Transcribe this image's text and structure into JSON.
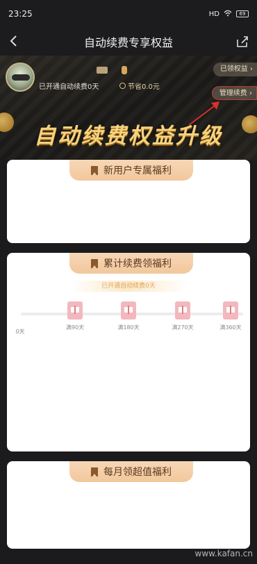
{
  "status_bar": {
    "time": "23:25",
    "signal": "HD",
    "wifi": "wifi-icon",
    "battery": "69"
  },
  "nav": {
    "title": "自动续费专享权益",
    "back_icon": "chevron-left-icon",
    "share_icon": "share-icon"
  },
  "header": {
    "renew_days": "已开通自动续费0天",
    "saved": "节省0.0元",
    "received_pill": "已领权益 ›",
    "manage_pill": "管理续费 ›",
    "banner_title": "自动续费权益升级"
  },
  "cards": {
    "new_user": {
      "title": "新用户专属福利"
    },
    "cumulative": {
      "title": "累计续费领福利",
      "renew_banner": "已开通自动续费0天",
      "milestones": [
        {
          "label": "0天",
          "has_gift": false
        },
        {
          "label": "满90天",
          "has_gift": true
        },
        {
          "label": "满180天",
          "has_gift": true
        },
        {
          "label": "满270天",
          "has_gift": true
        },
        {
          "label": "满360天",
          "has_gift": true
        }
      ]
    },
    "monthly": {
      "title": "每月领超值福利"
    }
  },
  "watermark": "www.kafan.cn",
  "colors": {
    "accent_gold": "#f7d27e",
    "tab_bg": "#f2c79c",
    "annotation_red": "#d9322a",
    "gift_pink": "#f2b8bd"
  }
}
